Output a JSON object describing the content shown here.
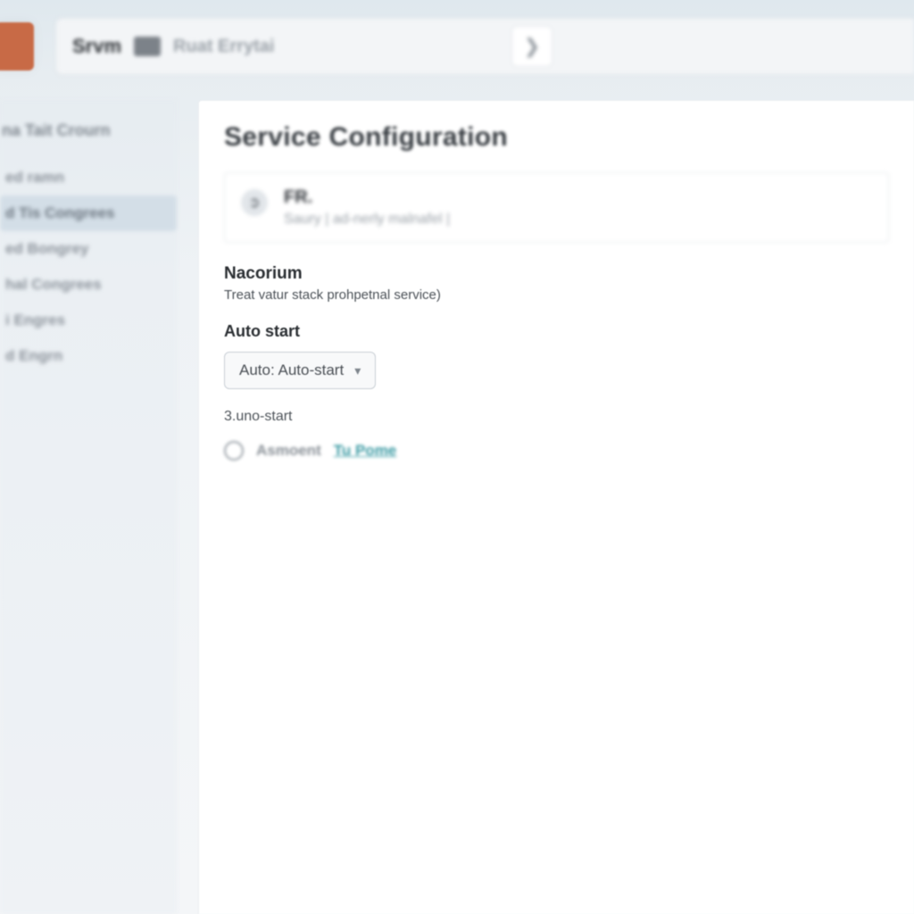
{
  "header": {
    "crumb_primary": "Srvm",
    "crumb_secondary": "Ruat Errytai"
  },
  "sidebar": {
    "heading": "na Tait Crourn",
    "items": [
      {
        "label": "ed ramn"
      },
      {
        "label": "d Tis Congrees"
      },
      {
        "label": "ed Bongrey"
      },
      {
        "label": "hal Congrees"
      },
      {
        "label": "i Engres"
      },
      {
        "label": "d Engrn"
      }
    ],
    "active_index": 1
  },
  "page": {
    "title": "Service Configuration",
    "service_row": {
      "title": "FR.",
      "subtitle": "Saury | ad-nerly malnafel |"
    },
    "section": {
      "title": "Nacorium",
      "description": "Treat vatur stack prohpetnal service)"
    },
    "autostart": {
      "label": "Auto start",
      "selected": "Auto: Auto-start",
      "note": "3.uno-start"
    },
    "option_row": {
      "prefix": "Asmoent",
      "link": "Tu Pome"
    }
  }
}
